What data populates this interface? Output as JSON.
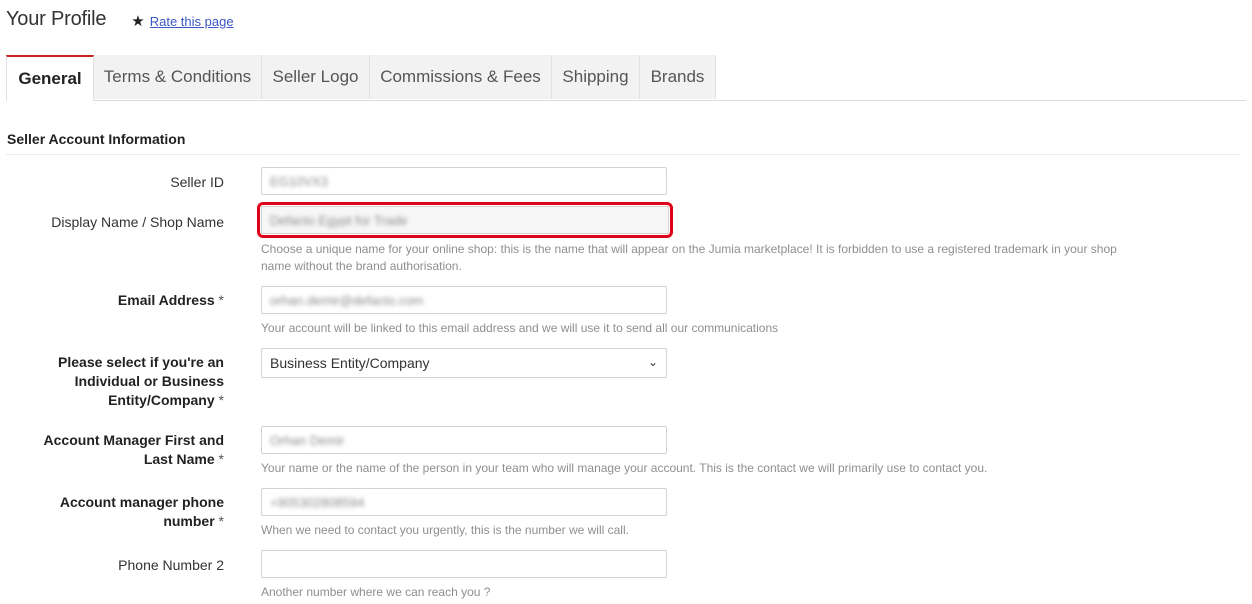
{
  "header": {
    "title": "Your Profile",
    "rate_label": "Rate this page"
  },
  "tabs": [
    {
      "label": "General",
      "active": true
    },
    {
      "label": "Terms & Conditions"
    },
    {
      "label": "Seller Logo"
    },
    {
      "label": "Commissions & Fees"
    },
    {
      "label": "Shipping"
    },
    {
      "label": "Brands"
    }
  ],
  "section": {
    "title": "Seller Account Information"
  },
  "fields": {
    "seller_id": {
      "label": "Seller ID",
      "value": "EG10VX3"
    },
    "display_name": {
      "label": "Display Name / Shop Name",
      "value": "Defacto Egypt for Trade",
      "help_line1": "Choose a unique name for your online shop: this is the name that will appear on the Jumia marketplace! It is forbidden to use a registered trademark in your shop",
      "help_line2": "name without the brand authorisation."
    },
    "email": {
      "label": "Email Address",
      "required": "*",
      "value": "orhan.demir@defacto.com",
      "help": "Your account will be linked to this email address and we will use it to send all our communications"
    },
    "entity_type": {
      "label_line1": "Please select if you're an",
      "label_line2": "Individual or Business",
      "label_line3": "Entity/Company",
      "required": "*",
      "value": "Business Entity/Company"
    },
    "account_manager": {
      "label_line1": "Account Manager First and",
      "label_line2": "Last Name",
      "required": "*",
      "value": "Orhan Demir",
      "help": "Your name or the name of the person in your team who will manage your account. This is the contact we will primarily use to contact you."
    },
    "phone": {
      "label_line1": "Account manager phone",
      "label_line2": "number",
      "required": "*",
      "value": "+905302808594",
      "help": "When we need to contact you urgently, this is the number we will call."
    },
    "phone2": {
      "label": "Phone Number 2",
      "value": "",
      "help": "Another number where we can reach you ?"
    }
  },
  "icons": {
    "rate": "star-icon",
    "select": "chevron-down-icon"
  },
  "colors": {
    "tab_accent": "#c5251f",
    "highlight": "#e0001a",
    "link": "#3a57c4"
  }
}
